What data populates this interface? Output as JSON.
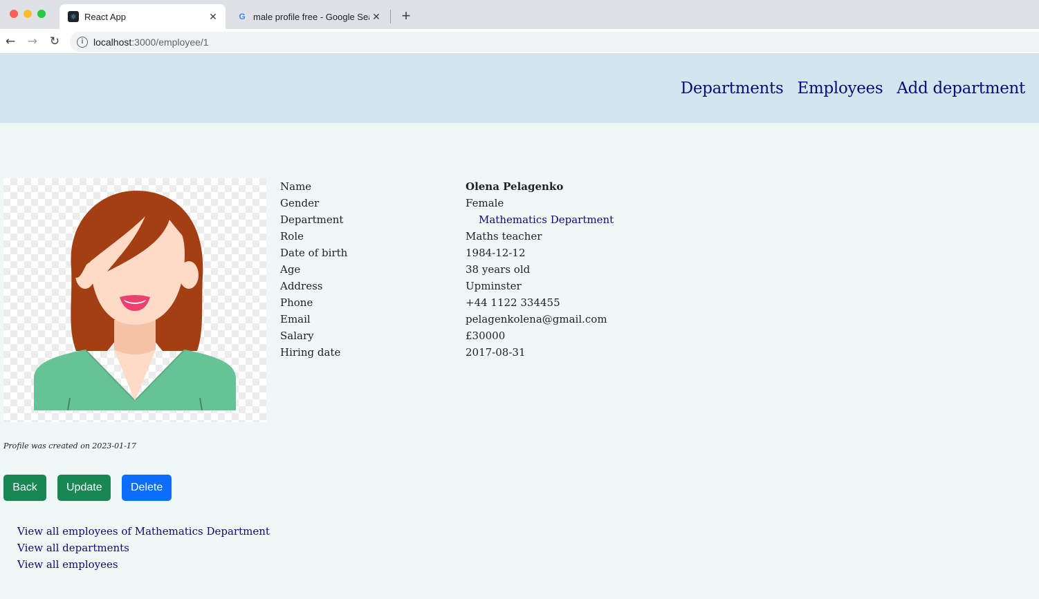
{
  "browser": {
    "tabs": [
      {
        "title": "React App",
        "icon": "react-icon",
        "active": true
      },
      {
        "title": "male profile free - Google Search",
        "icon": "google-icon",
        "active": false
      }
    ],
    "close_glyph": "✕",
    "new_tab_glyph": "+",
    "url_host": "localhost",
    "url_path": ":3000/employee/1",
    "back_glyph": "←",
    "forward_glyph": "→",
    "reload_glyph": "↻",
    "info_glyph": "i"
  },
  "nav": {
    "departments": "Departments",
    "employees": "Employees",
    "add_department": "Add department"
  },
  "profile": {
    "rows": [
      {
        "label": "Name",
        "value": "Olena Pelagenko"
      },
      {
        "label": "Gender",
        "value": "Female"
      },
      {
        "label": "Department",
        "value": "Mathematics Department"
      },
      {
        "label": "Role",
        "value": "Maths teacher"
      },
      {
        "label": "Date of birth",
        "value": "1984-12-12"
      },
      {
        "label": "Age",
        "value": "38 years old"
      },
      {
        "label": "Address",
        "value": "Upminster"
      },
      {
        "label": "Phone",
        "value": "+44 1122 334455"
      },
      {
        "label": "Email",
        "value": "pelagenkolena@gmail.com"
      },
      {
        "label": "Salary",
        "value": "£30000"
      },
      {
        "label": "Hiring date",
        "value": "2017-08-31"
      }
    ],
    "created_note": "Profile was created on 2023-01-17"
  },
  "actions": {
    "back": "Back",
    "update": "Update",
    "delete": "Delete"
  },
  "links": {
    "dept_employees": "View all employees of Mathematics Department",
    "all_departments": "View all departments",
    "all_employees": "View all employees"
  },
  "colors": {
    "header_bg": "#d4e5ef",
    "page_bg": "#eff7f7",
    "link": "#0a0a7a",
    "success": "#198754",
    "primary": "#0d6efd"
  }
}
